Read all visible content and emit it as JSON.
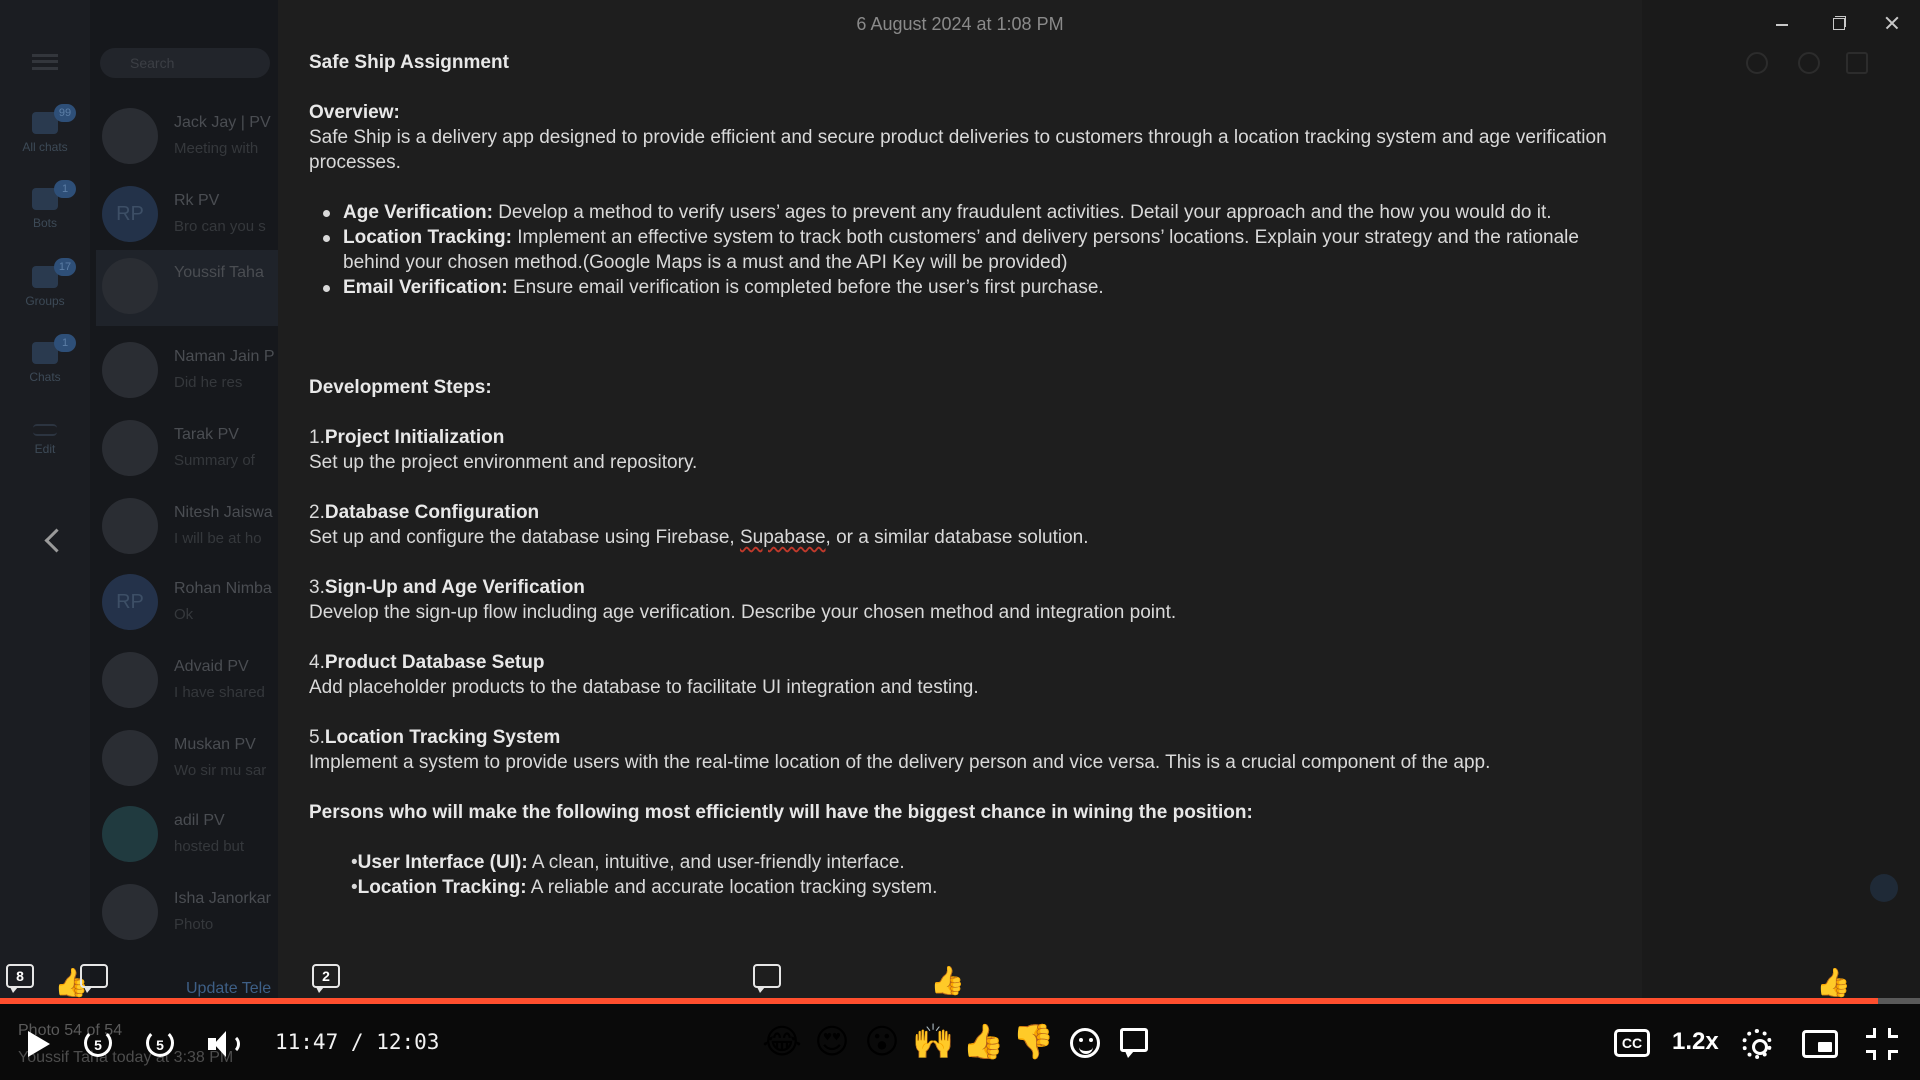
{
  "window": {
    "date": "6 August 2024 at 1:08 PM"
  },
  "background_app": {
    "search_placeholder": "Search",
    "folders": [
      {
        "label": "All chats",
        "badge": "99"
      },
      {
        "label": "Bots",
        "badge": "1"
      },
      {
        "label": "Groups",
        "badge": "17"
      },
      {
        "label": "Chats",
        "badge": "1"
      },
      {
        "label": "Edit",
        "badge": ""
      }
    ],
    "chats": [
      {
        "name": "Jack Jay | PV",
        "message": "Meeting with",
        "initials": ""
      },
      {
        "name": "Rk PV",
        "message": "Bro can you s",
        "initials": "RP"
      },
      {
        "name": "Youssif Taha",
        "message": "",
        "initials": ""
      },
      {
        "name": "Naman Jain P",
        "message": "Did he res",
        "initials": ""
      },
      {
        "name": "Tarak PV",
        "message": "Summary of",
        "initials": ""
      },
      {
        "name": "Nitesh Jaiswa",
        "message": "I will be at ho",
        "initials": ""
      },
      {
        "name": "Rohan Nimba",
        "message": "Ok",
        "initials": "RP"
      },
      {
        "name": "Advaid PV",
        "message": "I have shared",
        "initials": ""
      },
      {
        "name": "Muskan PV",
        "message": "Wo sir mu sar",
        "initials": ""
      },
      {
        "name": "adil PV",
        "message": "hosted but",
        "initials": ""
      },
      {
        "name": "Isha Janorkar",
        "message": "Photo",
        "initials": ""
      }
    ],
    "update_text": "Update Tele"
  },
  "document": {
    "title": "Safe Ship Assignment",
    "overview_heading": "Overview:",
    "overview_text": "Safe Ship is a delivery app designed to provide efficient and secure product deliveries to customers through a location tracking system and age verification processes.",
    "requirements": [
      {
        "label": "Age Verification:",
        "text": " Develop a method to verify users’ ages to prevent any fraudulent activities. Detail your approach and the how you would do it."
      },
      {
        "label": "Location Tracking:",
        "text": " Implement an effective system to track both customers’ and delivery persons’ locations. Explain your strategy and the rationale behind your chosen method.(Google Maps is a must and the API Key will be provided)"
      },
      {
        "label": "Email Verification:",
        "text": " Ensure email verification is completed before the user’s first purchase."
      }
    ],
    "dev_heading": "Development Steps:",
    "steps": [
      {
        "num": "1.",
        "title": "Project Initialization",
        "desc": "Set up the project environment and repository."
      },
      {
        "num": "2.",
        "title": "Database Configuration",
        "desc_pre": "Set up and configure the database using Firebase, ",
        "desc_mark": "Supabase",
        "desc_post": ", or a similar database solution."
      },
      {
        "num": "3.",
        "title": "Sign-Up and Age Verification",
        "desc": "Develop the sign-up flow including age verification. Describe your chosen method and integration point."
      },
      {
        "num": "4.",
        "title": "Product Database Setup",
        "desc": "Add placeholder products to the database to facilitate UI integration and testing."
      },
      {
        "num": "5.",
        "title": "Location Tracking System",
        "desc": "Implement a system to provide users with the real-time location of the delivery person and vice versa. This is a crucial component of the app."
      }
    ],
    "criteria_heading": "Persons who will make the following most efficiently will have the biggest chance in wining the position:",
    "criteria": [
      {
        "bullet": "•",
        "label": "User Interface (UI):",
        "text": " A clean, intuitive, and user-friendly interface."
      },
      {
        "bullet": "•",
        "label": "Location Tracking:",
        "text": " A reliable and accurate location tracking system."
      }
    ]
  },
  "timeline_markers": {
    "comment_count_a": "8",
    "comment_count_b": "2",
    "thumbs_icon": "👍"
  },
  "player": {
    "progress_fraction": 0.978,
    "current_time": "11:47",
    "separator": "/",
    "duration": "12:03",
    "rewind_seconds": "5",
    "forward_seconds": "5",
    "speed": "1.2x",
    "cc_label": "CC",
    "photo_caption": "Photo 54 of 54",
    "photo_sender": "Youssif Taha  today at 3:38 PM",
    "reactions": [
      "😂",
      "😍",
      "😮",
      "🙌",
      "👍",
      "👎"
    ],
    "accent_color": "#ff4f2e"
  }
}
